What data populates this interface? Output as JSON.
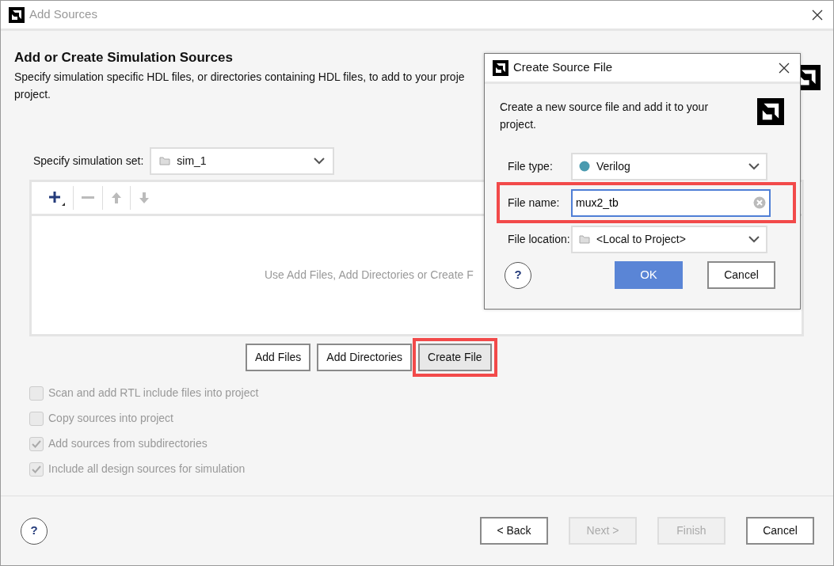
{
  "window": {
    "title": "Add Sources"
  },
  "heading": "Add or Create Simulation Sources",
  "description": [
    "Specify simulation specific HDL files, or directories containing HDL files, to add to your proje",
    "project."
  ],
  "simulation_set": {
    "label": "Specify simulation set:",
    "value": "sim_1"
  },
  "toolbar": [
    {
      "kind": "add",
      "disabled": false
    },
    {
      "kind": "remove",
      "disabled": true
    },
    {
      "kind": "up",
      "disabled": true
    },
    {
      "kind": "down",
      "disabled": true
    }
  ],
  "list_empty_text": "Use Add Files, Add Directories or Create F",
  "action_buttons": [
    {
      "label": "Add Files",
      "highlighted": false
    },
    {
      "label": "Add Directories",
      "highlighted": false
    },
    {
      "label": "Create File",
      "highlighted": true
    }
  ],
  "options": [
    {
      "label": "Scan and add RTL include files into project",
      "checked": false,
      "disabled": true
    },
    {
      "label": "Copy sources into project",
      "checked": false,
      "disabled": true
    },
    {
      "label": "Add sources from subdirectories",
      "checked": true,
      "disabled": true
    },
    {
      "label": "Include all design sources for simulation",
      "checked": true,
      "disabled": true
    }
  ],
  "help_button": "?",
  "footer_buttons": [
    {
      "label": "< Back",
      "disabled": false
    },
    {
      "label": "Next >",
      "disabled": true
    },
    {
      "label": "Finish",
      "disabled": true
    },
    {
      "label": "Cancel",
      "disabled": false
    }
  ],
  "dialog": {
    "title": "Create Source File",
    "description": "Create a new source file and add it to your project.",
    "fields": [
      {
        "kind": "select",
        "label": "File type:",
        "value": "Verilog",
        "color": "#4a9aaf",
        "highlighted": false
      },
      {
        "kind": "input",
        "label": "File name:",
        "value": "mux2_tb",
        "highlighted": true
      },
      {
        "kind": "select",
        "label": "File location:",
        "value": "<Local to Project>",
        "highlighted": false
      }
    ],
    "help_button": "?",
    "buttons": [
      {
        "label": "OK",
        "primary": true
      },
      {
        "label": "Cancel",
        "primary": false
      }
    ]
  }
}
